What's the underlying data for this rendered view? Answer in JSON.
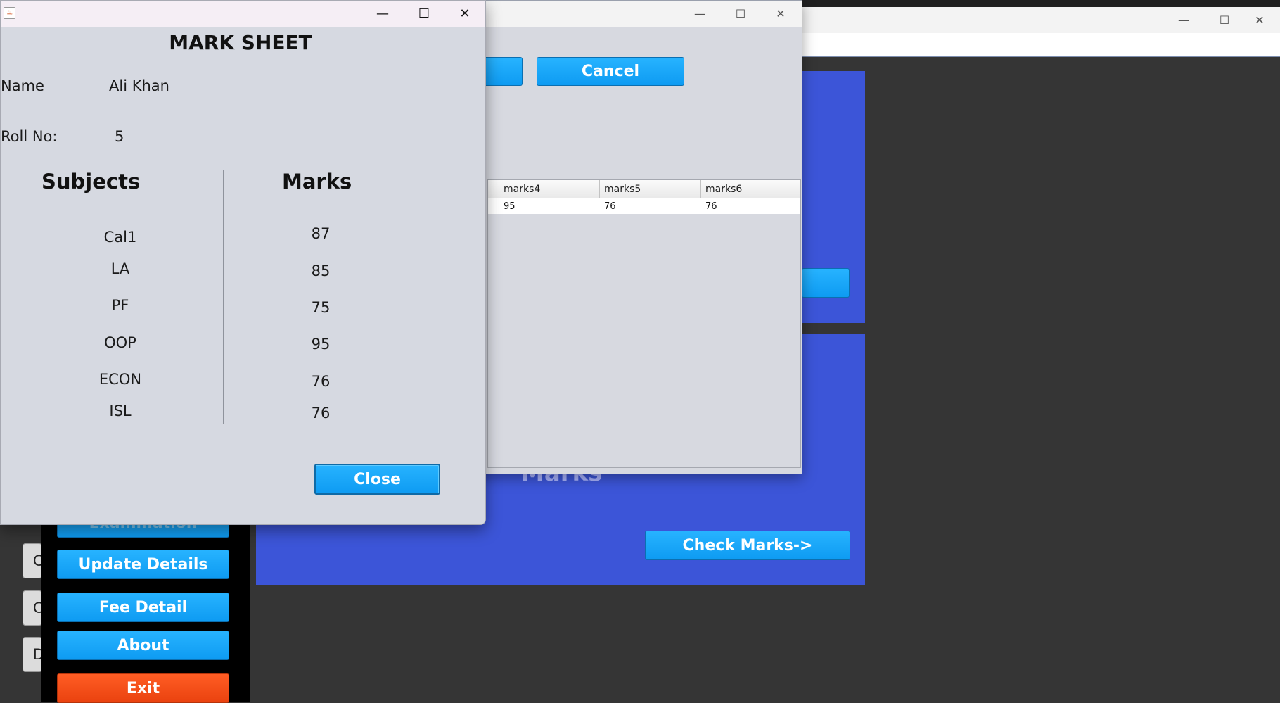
{
  "background_window": {
    "controls": [
      "—",
      "☐",
      "✕"
    ],
    "marks_text": "Marks",
    "check_marks_label": "Check Marks->",
    "colors": {
      "panel": "#3c55d8",
      "button": "#1aa7f7"
    }
  },
  "sidebar": {
    "exam_label": "Examination",
    "update_details_label": "Update Details",
    "fee_detail_label": "Fee Detail",
    "about_label": "About",
    "exit_label": "Exit",
    "stub_letters": [
      "C",
      "C",
      "D"
    ],
    "colors": {
      "exit": "#f04c14"
    }
  },
  "middle_window": {
    "controls": [
      "—",
      "☐",
      "✕"
    ],
    "cancel_label": "Cancel",
    "table": {
      "columns": [
        "marks4",
        "marks5",
        "marks6"
      ],
      "rows": [
        [
          "95",
          "76",
          "76"
        ]
      ]
    }
  },
  "dialog": {
    "title": "MARK SHEET",
    "controls": [
      "—",
      "☐",
      "✕"
    ],
    "icon": "java-icon",
    "name_label": "Name",
    "name_value": "Ali Khan",
    "roll_label": "Roll No:",
    "roll_value": "5",
    "subjects_heading": "Subjects",
    "marks_heading": "Marks",
    "subjects": [
      "Cal1",
      "LA",
      "PF",
      "OOP",
      "ECON",
      "ISL"
    ],
    "marks": [
      "87",
      "85",
      "75",
      "95",
      "76",
      "76"
    ],
    "close_label": "Close"
  }
}
